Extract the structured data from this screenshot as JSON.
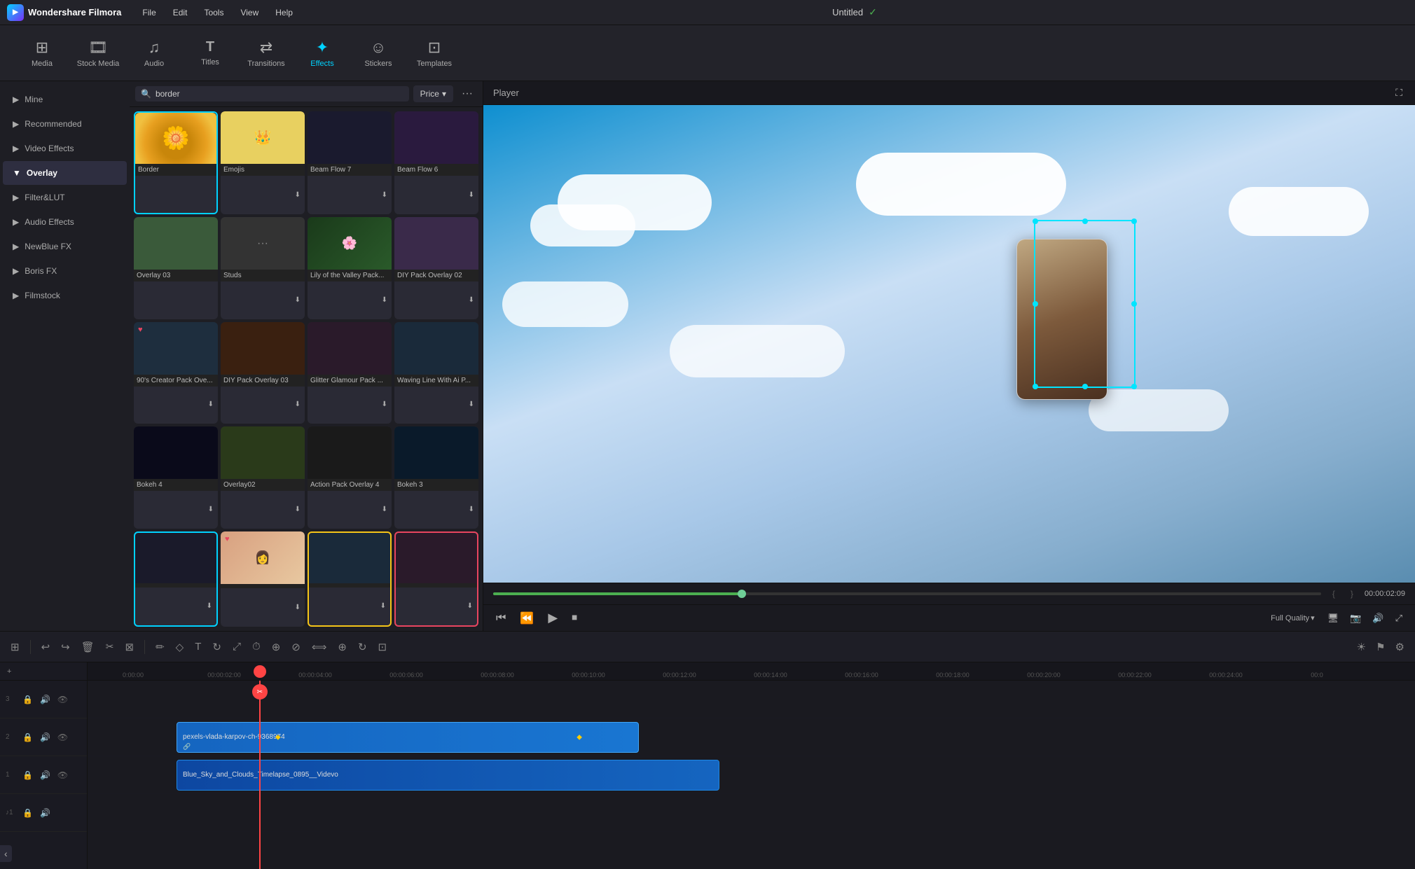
{
  "app": {
    "name": "Wondershare Filmora",
    "title": "Untitled",
    "logo_icon": "▶"
  },
  "menu": {
    "items": [
      "File",
      "Edit",
      "Tools",
      "View",
      "Help"
    ]
  },
  "toolbar": {
    "items": [
      {
        "id": "media",
        "icon": "⊞",
        "label": "Media"
      },
      {
        "id": "stock",
        "icon": "📷",
        "label": "Stock Media"
      },
      {
        "id": "audio",
        "icon": "♫",
        "label": "Audio"
      },
      {
        "id": "titles",
        "icon": "T",
        "label": "Titles"
      },
      {
        "id": "transitions",
        "icon": "⇄",
        "label": "Transitions"
      },
      {
        "id": "effects",
        "icon": "✦",
        "label": "Effects"
      },
      {
        "id": "stickers",
        "icon": "🙂",
        "label": "Stickers"
      },
      {
        "id": "templates",
        "icon": "⊡",
        "label": "Templates"
      }
    ],
    "active": "effects"
  },
  "sidebar": {
    "items": [
      {
        "id": "mine",
        "label": "Mine",
        "active": false
      },
      {
        "id": "recommended",
        "label": "Recommended",
        "active": false
      },
      {
        "id": "video_effects",
        "label": "Video Effects",
        "active": false
      },
      {
        "id": "overlay",
        "label": "Overlay",
        "active": true
      },
      {
        "id": "filter_lut",
        "label": "Filter&LUT",
        "active": false
      },
      {
        "id": "audio_effects",
        "label": "Audio Effects",
        "active": false
      },
      {
        "id": "newblue_fx",
        "label": "NewBlue FX",
        "active": false
      },
      {
        "id": "boris_fx",
        "label": "Boris FX",
        "active": false
      },
      {
        "id": "filmstock",
        "label": "Filmstock",
        "active": false
      }
    ]
  },
  "effects_search": {
    "placeholder": "border",
    "price_label": "Price",
    "more_icon": "···"
  },
  "effects_grid": {
    "items": [
      {
        "id": 1,
        "label": "Border",
        "selected": "cyan",
        "has_heart": false,
        "has_download": false,
        "bg": "#c8860a"
      },
      {
        "id": 2,
        "label": "Emojis",
        "selected": false,
        "has_heart": false,
        "has_download": true,
        "bg": "#e8d060"
      },
      {
        "id": 3,
        "label": "Beam Flow 7",
        "selected": false,
        "has_heart": false,
        "has_download": true,
        "bg": "#1a1a2e"
      },
      {
        "id": 4,
        "label": "Beam Flow 6",
        "selected": false,
        "has_heart": false,
        "has_download": true,
        "bg": "#2a1a3e"
      },
      {
        "id": 5,
        "label": "Overlay 03",
        "selected": false,
        "has_heart": false,
        "has_download": false,
        "bg": "#3a5a3a"
      },
      {
        "id": 6,
        "label": "Studs",
        "selected": false,
        "has_heart": false,
        "has_download": true,
        "bg": "#2a2a2a"
      },
      {
        "id": 7,
        "label": "Lily of the Valley Pack...",
        "selected": false,
        "has_heart": false,
        "has_download": true,
        "bg": "#1a3a1a"
      },
      {
        "id": 8,
        "label": "DIY Pack Overlay 02",
        "selected": false,
        "has_heart": false,
        "has_download": true,
        "bg": "#3a2a4a"
      },
      {
        "id": 9,
        "label": "90's Creator Pack Ove...",
        "selected": false,
        "has_heart": true,
        "has_download": true,
        "bg": "#1e2e3e"
      },
      {
        "id": 10,
        "label": "DIY Pack Overlay 03",
        "selected": false,
        "has_heart": false,
        "has_download": true,
        "bg": "#3a2010"
      },
      {
        "id": 11,
        "label": "Glitter Glamour Pack ...",
        "selected": false,
        "has_heart": false,
        "has_download": true,
        "bg": "#2a1a2a"
      },
      {
        "id": 12,
        "label": "Waving Line With Ai P...",
        "selected": false,
        "has_heart": false,
        "has_download": true,
        "bg": "#1a2a3a"
      },
      {
        "id": 13,
        "label": "Bokeh 4",
        "selected": false,
        "has_heart": false,
        "has_download": true,
        "bg": "#0a0a1a"
      },
      {
        "id": 14,
        "label": "Overlay02",
        "selected": false,
        "has_heart": false,
        "has_download": true,
        "bg": "#2a3a1a"
      },
      {
        "id": 15,
        "label": "Action Pack Overlay 4",
        "selected": false,
        "has_heart": false,
        "has_download": true,
        "bg": "#1a1a1a"
      },
      {
        "id": 16,
        "label": "Bokeh 3",
        "selected": false,
        "has_heart": false,
        "has_download": true,
        "bg": "#0a1a2a"
      },
      {
        "id": 17,
        "label": "",
        "selected": "cyan",
        "has_heart": false,
        "has_download": true,
        "bg": "#1a1a2a"
      },
      {
        "id": 18,
        "label": "",
        "selected": false,
        "has_heart": true,
        "has_download": true,
        "bg": "#e8d8c8"
      },
      {
        "id": 19,
        "label": "",
        "selected": "yellow",
        "has_heart": false,
        "has_download": true,
        "bg": "#1a2a3a"
      },
      {
        "id": 20,
        "label": "",
        "selected": "pink",
        "has_heart": false,
        "has_download": true,
        "bg": "#2a1a2a"
      }
    ]
  },
  "player": {
    "title": "Player",
    "time": "00:00:02:09",
    "quality": "Full Quality",
    "expand_icon": "⛶"
  },
  "timeline": {
    "ruler_marks": [
      "0:00:00",
      "00:00:02:00",
      "00:00:04:00",
      "00:00:06:00",
      "00:00:08:00",
      "00:00:10:00",
      "00:00:12:00",
      "00:00:14:00",
      "00:00:16:00",
      "00:00:18:00",
      "00:00:20:00",
      "00:00:22:00",
      "00:00:24:00",
      "00:0"
    ],
    "tracks": [
      {
        "num": 3,
        "type": "video",
        "label": ""
      },
      {
        "num": 2,
        "type": "video",
        "label": "pexels-vlada-karpov-ch-9368974"
      },
      {
        "num": 1,
        "type": "video",
        "label": "Blue_Sky_and_Clouds_Timelapse_0895__Videvo"
      },
      {
        "num": 1,
        "type": "audio",
        "label": ""
      }
    ],
    "toolbar_btns": [
      "⊞",
      "↩",
      "↪",
      "🗑",
      "✂",
      "⊠",
      "✎",
      "⚙",
      "|",
      "☐",
      "T",
      "↻",
      "↗",
      "⤢",
      "⏱",
      "⊕",
      "⊘",
      "⟺",
      "⊕",
      "↻",
      "⊡"
    ]
  }
}
